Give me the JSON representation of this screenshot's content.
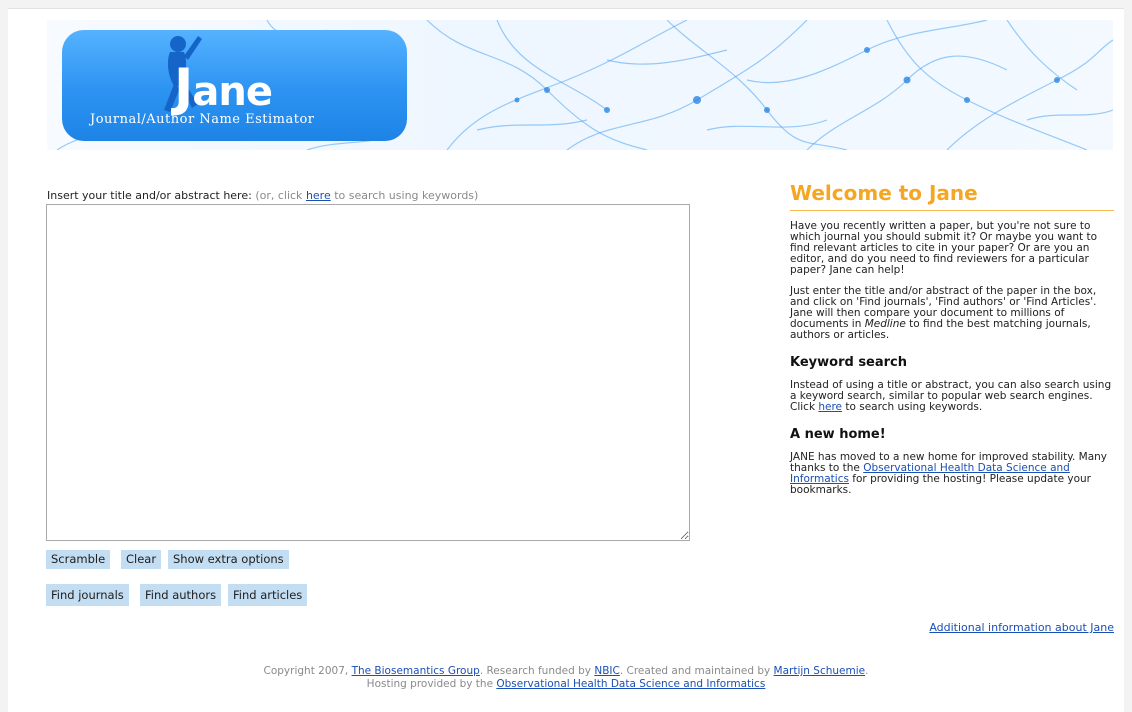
{
  "logo": {
    "title": "ane",
    "title_initial": "J",
    "subtitle": "Journal/Author Name Estimator"
  },
  "search": {
    "intro_label": "Insert your title and/or abstract here:",
    "hint_prefix": "(or, click ",
    "hint_link": "here",
    "hint_suffix": " to search using keywords)",
    "abstract_value": ""
  },
  "buttons": {
    "scramble": "Scramble",
    "clear": "Clear",
    "extra_options": "Show extra options",
    "find_journals": "Find journals",
    "find_authors": "Find authors",
    "find_articles": "Find articles"
  },
  "sidebar": {
    "welcome_title": "Welcome to Jane",
    "intro_para": "Have you recently written a paper, but you're not sure to which journal you should submit it? Or maybe you want to find relevant articles to cite in your paper? Or are you an editor, and do you need to find reviewers for a particular paper? Jane can help!",
    "how_para_1": "Just enter the title and/or abstract of the paper in the box, and click on 'Find journals', 'Find authors' or 'Find Articles'. Jane will then compare your document to millions of documents in ",
    "how_para_medline": "Medline",
    "how_para_2": " to find the best matching journals, authors or articles.",
    "keyword_heading": "Keyword search",
    "keyword_para_1": "Instead of using a title or abstract, you can also search using a keyword search, similar to popular web search engines. Click ",
    "keyword_link": "here",
    "keyword_para_2": " to search using keywords.",
    "home_heading": "A new home!",
    "home_para_1": "JANE has moved to a new home for improved stability. Many thanks to the ",
    "home_link": "Observational Health Data Science and Informatics",
    "home_para_2": " for providing the hosting! Please update your bookmarks.",
    "more_info_link": "Additional information about Jane"
  },
  "footer": {
    "line1_a": "Copyright 2007, ",
    "biosemantics_link": "The Biosemantics Group",
    "line1_b": ". Research funded by ",
    "nbic_link": "NBIC",
    "line1_c": ". Created and maintained by ",
    "author_link": "Martijn Schuemie",
    "line1_d": ".",
    "line2_a": "Hosting provided by the ",
    "ohdsi_link": "Observational Health Data Science and Informatics"
  },
  "colors": {
    "accent_orange": "#f5a623",
    "button_blue": "#c3ddf3",
    "logo_blue": "#2c93f2",
    "link_blue": "#1a4fb5"
  }
}
